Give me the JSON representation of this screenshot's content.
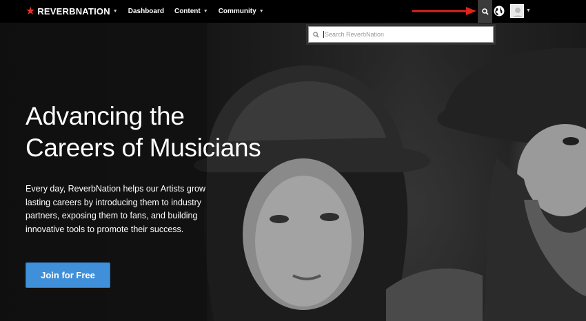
{
  "brand": {
    "wordmark": "REVERBNATION",
    "accent": "#e0342b"
  },
  "nav": {
    "items": [
      {
        "label": "Dashboard",
        "has_caret": false
      },
      {
        "label": "Content",
        "has_caret": true
      },
      {
        "label": "Community",
        "has_caret": true
      }
    ],
    "search_icon": "search-icon",
    "globe_icon": "globe-icon",
    "avatar_icon": "user-avatar"
  },
  "search": {
    "placeholder": "Search ReverbNation",
    "value": ""
  },
  "hero": {
    "headline_line1": "Advancing the",
    "headline_line2": "Careers of Musicians",
    "tagline": "Every day, ReverbNation helps our Artists grow lasting careers by introducing them to industry partners, exposing them to fans, and building innovative tools to promote their success.",
    "cta_label": "Join for Free",
    "cta_color": "#3f8fd9"
  },
  "annotation": {
    "arrow_color": "#e0231b"
  }
}
